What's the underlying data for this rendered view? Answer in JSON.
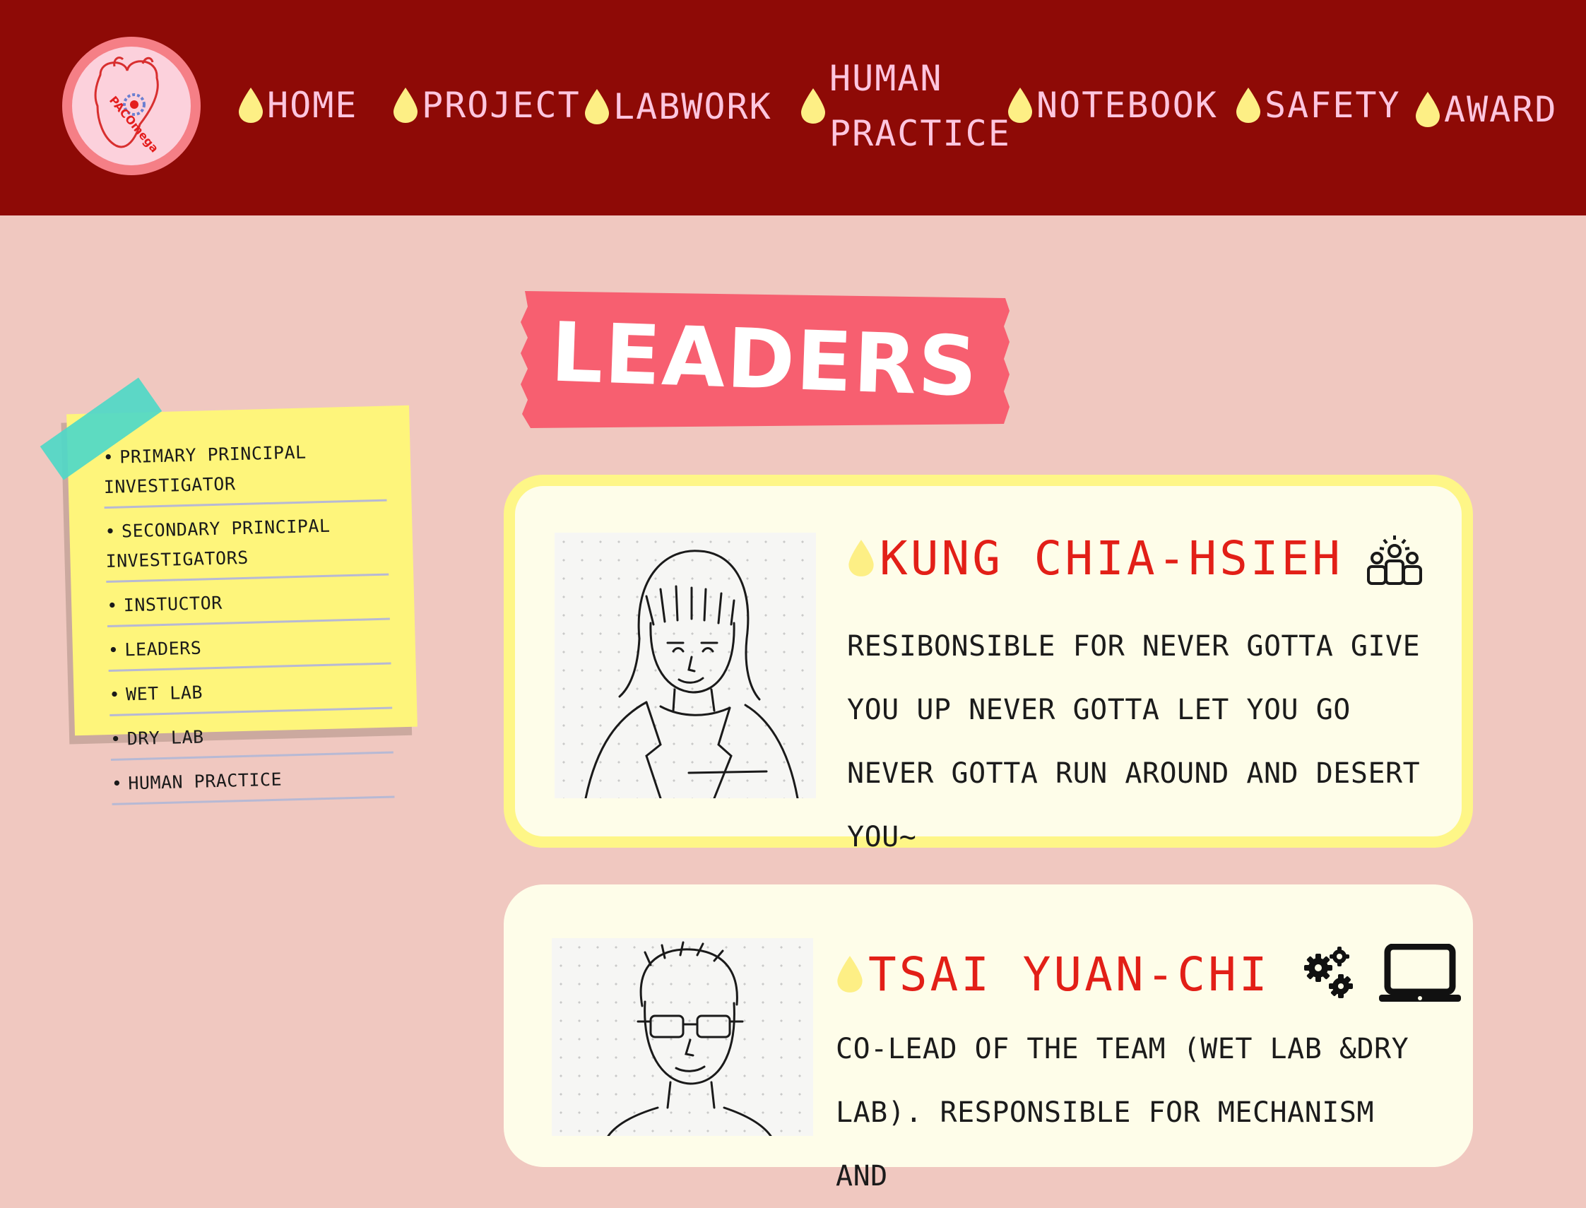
{
  "logo": {
    "text": "PACOmega",
    "icon": "heart-gear-logo"
  },
  "nav": {
    "items": [
      {
        "label": "HOME"
      },
      {
        "label": "PROJECT"
      },
      {
        "label": "LABWORK"
      },
      {
        "label_line1": "HUMAN",
        "label_line2": "PRACTICE"
      },
      {
        "label": "NOTEBOOK"
      },
      {
        "label": "SAFETY"
      },
      {
        "label": "AWARD"
      }
    ],
    "drop_color": "#fdef85"
  },
  "banner": {
    "title": "LEADERS",
    "color": "#f75f70"
  },
  "sidebar": {
    "items": [
      {
        "label": "PRIMARY PRINCIPAL INVESTIGATOR"
      },
      {
        "label": "SECONDARY PRINCIPAL INVESTIGATORS"
      },
      {
        "label": "INSTUCTOR"
      },
      {
        "label": "LEADERS"
      },
      {
        "label": "WET LAB"
      },
      {
        "label": "DRY LAB"
      },
      {
        "label": "HUMAN PRACTICE"
      }
    ]
  },
  "members": [
    {
      "name": "KUNG CHIA-HSIEH",
      "icon": "team-leader-icon",
      "description": "RESIBONSIBLE FOR NEVER GOTTA GIVE YOU UP NEVER GOTTA LET YOU GO NEVER GOTTA RUN AROUND AND DESERT YOU~"
    },
    {
      "name": "TSAI YUAN-CHI",
      "icons": [
        "gears-icon",
        "laptop-icon"
      ],
      "description": "CO-LEAD OF THE TEAM (WET LAB &DRY LAB). RESPONSIBLE FOR MECHANISM AND"
    }
  ],
  "colors": {
    "topbar": "#8e0a06",
    "background": "#f0c8c0",
    "nav_text": "#fdc6df",
    "name_text": "#e21f17",
    "note": "#fef57b",
    "tape": "#4fd8c7",
    "card_border": "#fef687"
  }
}
